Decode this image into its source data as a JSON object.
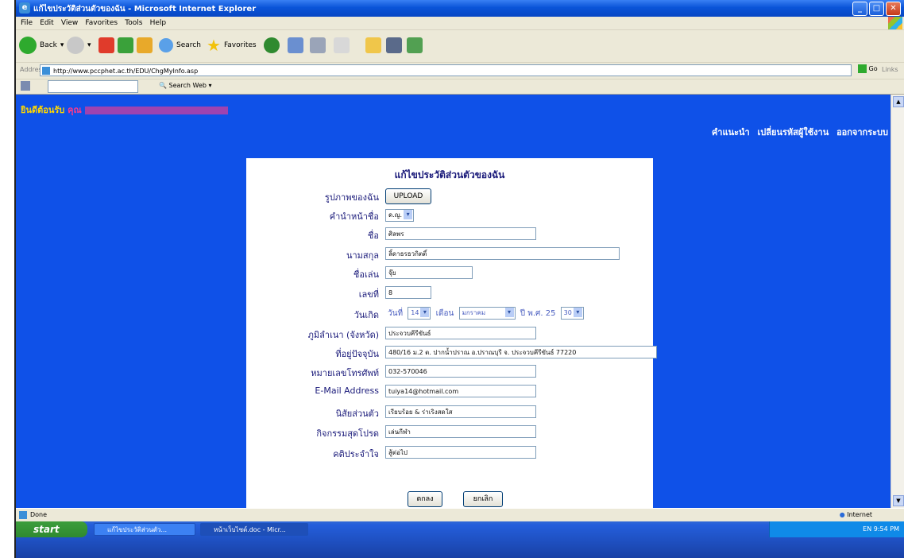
{
  "window": {
    "title": "แก้ไขประวัติส่วนตัวของฉัน - Microsoft Internet Explorer",
    "controls": [
      "_",
      "□",
      "✕"
    ]
  },
  "menu": [
    "File",
    "Edit",
    "View",
    "Favorites",
    "Tools",
    "Help"
  ],
  "toolbar": {
    "back": "Back",
    "search": "Search",
    "favorites": "Favorites"
  },
  "address": {
    "label": "Address",
    "url": "http://www.pccphet.ac.th/EDU/ChgMyInfo.asp",
    "go": "Go",
    "links": "Links"
  },
  "searchbar": {
    "web": "Search Web"
  },
  "page": {
    "welcome_prefix": "ยินดีต้อนรับ",
    "welcome_name": "คุณ ",
    "nav": [
      "คำแนะนำ",
      "เปลี่ยนรหัสผู้ใช้งาน",
      "ออกจากระบบ"
    ],
    "heading": "แก้ไขประวัติส่วนตัวของฉัน",
    "fields": [
      {
        "label": "รูปภาพของฉัน",
        "value": "UPLOAD"
      },
      {
        "label": "คำนำหน้าชื่อ",
        "value": "ด.ญ."
      },
      {
        "label": "ชื่อ",
        "value": "ศิลพร"
      },
      {
        "label": "นามสกุล",
        "value": "ลิ้ดาธรธวกิตติ์"
      },
      {
        "label": "ชื่อเล่น",
        "value": "จุ๊ย"
      },
      {
        "label": "เลขที่",
        "value": "8"
      },
      {
        "label": "วันเกิด",
        "day_label": "วันที่",
        "day": "14",
        "month_label": "เดือน",
        "month": "มกราคม",
        "year_label": "ปี พ.ศ. 25",
        "year": "30"
      },
      {
        "label": "ภูมิลำเนา (จังหวัด)",
        "value": "ประจวบคีรีขันธ์"
      },
      {
        "label": "ที่อยู่ปัจจุบัน",
        "value": "480/16 ม.2 ต. ปากน้ำปราณ อ.ปราณบุรี จ. ประจวบคีรีขันธ์ 77220"
      },
      {
        "label": "หมายเลขโทรศัพท์",
        "value": "032-570046"
      },
      {
        "label": "E-Mail Address",
        "value": "tuiya14@hotmail.com"
      },
      {
        "label": "นิสัยส่วนตัว",
        "value": "เรียบร้อย & ร่าเริงสดใส"
      },
      {
        "label": "กิจกรรมสุดโปรด",
        "value": "เล่นกีฬา"
      },
      {
        "label": "คติประจำใจ",
        "value": "สู้ต่อไป"
      }
    ],
    "submit": "ตกลง",
    "cancel": "ยกเลิก"
  },
  "status": {
    "left": "Done",
    "right": "Internet"
  },
  "taskbar": {
    "start": "start",
    "tasks": [
      "แก้ไขประวัติส่วนตัว...",
      "หน้าเว็บไซต์.doc - Micr..."
    ],
    "tray": "EN        9:54 PM"
  },
  "colors": {
    "page_bg": "#0f51e8",
    "label": "#1a1a7a",
    "welcome": "#ffd700"
  }
}
